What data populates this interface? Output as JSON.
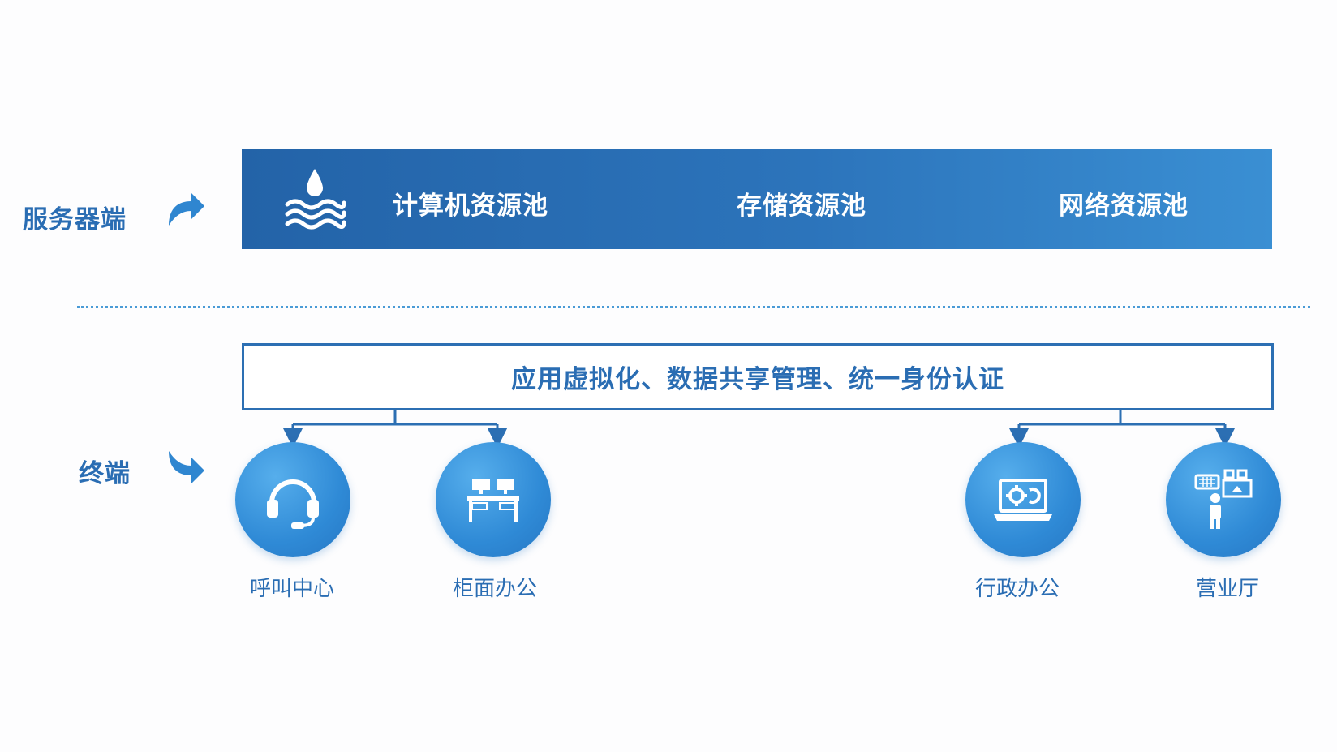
{
  "left_labels": {
    "server": "服务器端",
    "terminal": "终端"
  },
  "server_pools": [
    {
      "label": "计算机资源池",
      "icon": "water-pool-icon"
    },
    {
      "label": "存储资源池"
    },
    {
      "label": "网络资源池"
    }
  ],
  "functions": {
    "text": "应用虚拟化、数据共享管理、统一身份认证"
  },
  "terminals": [
    {
      "label": "呼叫中心",
      "icon": "headset-icon"
    },
    {
      "label": "柜面办公",
      "icon": "desk-icon"
    },
    {
      "label": "行政办公",
      "icon": "laptop-gear-icon"
    },
    {
      "label": "营业厅",
      "icon": "service-hall-icon"
    }
  ],
  "colors": {
    "primary": "#2a6db3",
    "bar_start": "#2363a8",
    "bar_end": "#3a8fd3",
    "circle": "#2f8ad6",
    "divider": "#4a9bd6"
  }
}
